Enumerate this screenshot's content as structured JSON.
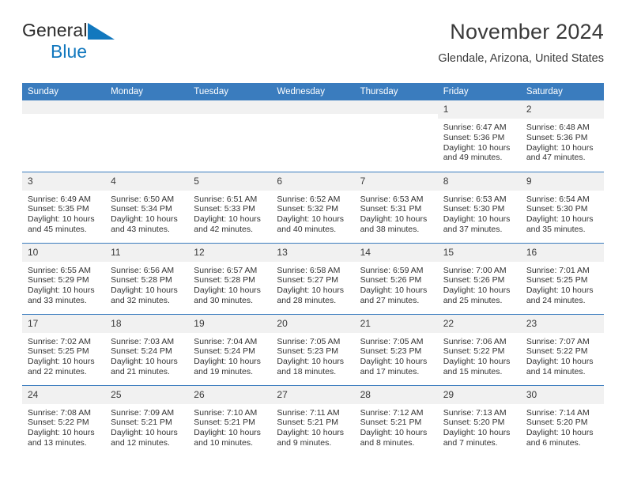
{
  "brand": {
    "name_part1": "General",
    "name_part2": "Blue",
    "mark": "triangle-logo-icon",
    "accent_color": "#1278be"
  },
  "header": {
    "title": "November 2024",
    "location": "Glendale, Arizona, United States"
  },
  "theme": {
    "header_band": "#3a7cbe",
    "daynum_band": "#f1f1f1",
    "text": "#333333"
  },
  "weekday_headers": [
    "Sunday",
    "Monday",
    "Tuesday",
    "Wednesday",
    "Thursday",
    "Friday",
    "Saturday"
  ],
  "weeks": [
    [
      {
        "day": "",
        "empty": true
      },
      {
        "day": "",
        "empty": true
      },
      {
        "day": "",
        "empty": true
      },
      {
        "day": "",
        "empty": true
      },
      {
        "day": "",
        "empty": true
      },
      {
        "day": "1",
        "sunrise": "Sunrise: 6:47 AM",
        "sunset": "Sunset: 5:36 PM",
        "daylight1": "Daylight: 10 hours",
        "daylight2": "and 49 minutes."
      },
      {
        "day": "2",
        "sunrise": "Sunrise: 6:48 AM",
        "sunset": "Sunset: 5:36 PM",
        "daylight1": "Daylight: 10 hours",
        "daylight2": "and 47 minutes."
      }
    ],
    [
      {
        "day": "3",
        "sunrise": "Sunrise: 6:49 AM",
        "sunset": "Sunset: 5:35 PM",
        "daylight1": "Daylight: 10 hours",
        "daylight2": "and 45 minutes."
      },
      {
        "day": "4",
        "sunrise": "Sunrise: 6:50 AM",
        "sunset": "Sunset: 5:34 PM",
        "daylight1": "Daylight: 10 hours",
        "daylight2": "and 43 minutes."
      },
      {
        "day": "5",
        "sunrise": "Sunrise: 6:51 AM",
        "sunset": "Sunset: 5:33 PM",
        "daylight1": "Daylight: 10 hours",
        "daylight2": "and 42 minutes."
      },
      {
        "day": "6",
        "sunrise": "Sunrise: 6:52 AM",
        "sunset": "Sunset: 5:32 PM",
        "daylight1": "Daylight: 10 hours",
        "daylight2": "and 40 minutes."
      },
      {
        "day": "7",
        "sunrise": "Sunrise: 6:53 AM",
        "sunset": "Sunset: 5:31 PM",
        "daylight1": "Daylight: 10 hours",
        "daylight2": "and 38 minutes."
      },
      {
        "day": "8",
        "sunrise": "Sunrise: 6:53 AM",
        "sunset": "Sunset: 5:30 PM",
        "daylight1": "Daylight: 10 hours",
        "daylight2": "and 37 minutes."
      },
      {
        "day": "9",
        "sunrise": "Sunrise: 6:54 AM",
        "sunset": "Sunset: 5:30 PM",
        "daylight1": "Daylight: 10 hours",
        "daylight2": "and 35 minutes."
      }
    ],
    [
      {
        "day": "10",
        "sunrise": "Sunrise: 6:55 AM",
        "sunset": "Sunset: 5:29 PM",
        "daylight1": "Daylight: 10 hours",
        "daylight2": "and 33 minutes."
      },
      {
        "day": "11",
        "sunrise": "Sunrise: 6:56 AM",
        "sunset": "Sunset: 5:28 PM",
        "daylight1": "Daylight: 10 hours",
        "daylight2": "and 32 minutes."
      },
      {
        "day": "12",
        "sunrise": "Sunrise: 6:57 AM",
        "sunset": "Sunset: 5:28 PM",
        "daylight1": "Daylight: 10 hours",
        "daylight2": "and 30 minutes."
      },
      {
        "day": "13",
        "sunrise": "Sunrise: 6:58 AM",
        "sunset": "Sunset: 5:27 PM",
        "daylight1": "Daylight: 10 hours",
        "daylight2": "and 28 minutes."
      },
      {
        "day": "14",
        "sunrise": "Sunrise: 6:59 AM",
        "sunset": "Sunset: 5:26 PM",
        "daylight1": "Daylight: 10 hours",
        "daylight2": "and 27 minutes."
      },
      {
        "day": "15",
        "sunrise": "Sunrise: 7:00 AM",
        "sunset": "Sunset: 5:26 PM",
        "daylight1": "Daylight: 10 hours",
        "daylight2": "and 25 minutes."
      },
      {
        "day": "16",
        "sunrise": "Sunrise: 7:01 AM",
        "sunset": "Sunset: 5:25 PM",
        "daylight1": "Daylight: 10 hours",
        "daylight2": "and 24 minutes."
      }
    ],
    [
      {
        "day": "17",
        "sunrise": "Sunrise: 7:02 AM",
        "sunset": "Sunset: 5:25 PM",
        "daylight1": "Daylight: 10 hours",
        "daylight2": "and 22 minutes."
      },
      {
        "day": "18",
        "sunrise": "Sunrise: 7:03 AM",
        "sunset": "Sunset: 5:24 PM",
        "daylight1": "Daylight: 10 hours",
        "daylight2": "and 21 minutes."
      },
      {
        "day": "19",
        "sunrise": "Sunrise: 7:04 AM",
        "sunset": "Sunset: 5:24 PM",
        "daylight1": "Daylight: 10 hours",
        "daylight2": "and 19 minutes."
      },
      {
        "day": "20",
        "sunrise": "Sunrise: 7:05 AM",
        "sunset": "Sunset: 5:23 PM",
        "daylight1": "Daylight: 10 hours",
        "daylight2": "and 18 minutes."
      },
      {
        "day": "21",
        "sunrise": "Sunrise: 7:05 AM",
        "sunset": "Sunset: 5:23 PM",
        "daylight1": "Daylight: 10 hours",
        "daylight2": "and 17 minutes."
      },
      {
        "day": "22",
        "sunrise": "Sunrise: 7:06 AM",
        "sunset": "Sunset: 5:22 PM",
        "daylight1": "Daylight: 10 hours",
        "daylight2": "and 15 minutes."
      },
      {
        "day": "23",
        "sunrise": "Sunrise: 7:07 AM",
        "sunset": "Sunset: 5:22 PM",
        "daylight1": "Daylight: 10 hours",
        "daylight2": "and 14 minutes."
      }
    ],
    [
      {
        "day": "24",
        "sunrise": "Sunrise: 7:08 AM",
        "sunset": "Sunset: 5:22 PM",
        "daylight1": "Daylight: 10 hours",
        "daylight2": "and 13 minutes."
      },
      {
        "day": "25",
        "sunrise": "Sunrise: 7:09 AM",
        "sunset": "Sunset: 5:21 PM",
        "daylight1": "Daylight: 10 hours",
        "daylight2": "and 12 minutes."
      },
      {
        "day": "26",
        "sunrise": "Sunrise: 7:10 AM",
        "sunset": "Sunset: 5:21 PM",
        "daylight1": "Daylight: 10 hours",
        "daylight2": "and 10 minutes."
      },
      {
        "day": "27",
        "sunrise": "Sunrise: 7:11 AM",
        "sunset": "Sunset: 5:21 PM",
        "daylight1": "Daylight: 10 hours",
        "daylight2": "and 9 minutes."
      },
      {
        "day": "28",
        "sunrise": "Sunrise: 7:12 AM",
        "sunset": "Sunset: 5:21 PM",
        "daylight1": "Daylight: 10 hours",
        "daylight2": "and 8 minutes."
      },
      {
        "day": "29",
        "sunrise": "Sunrise: 7:13 AM",
        "sunset": "Sunset: 5:20 PM",
        "daylight1": "Daylight: 10 hours",
        "daylight2": "and 7 minutes."
      },
      {
        "day": "30",
        "sunrise": "Sunrise: 7:14 AM",
        "sunset": "Sunset: 5:20 PM",
        "daylight1": "Daylight: 10 hours",
        "daylight2": "and 6 minutes."
      }
    ]
  ]
}
